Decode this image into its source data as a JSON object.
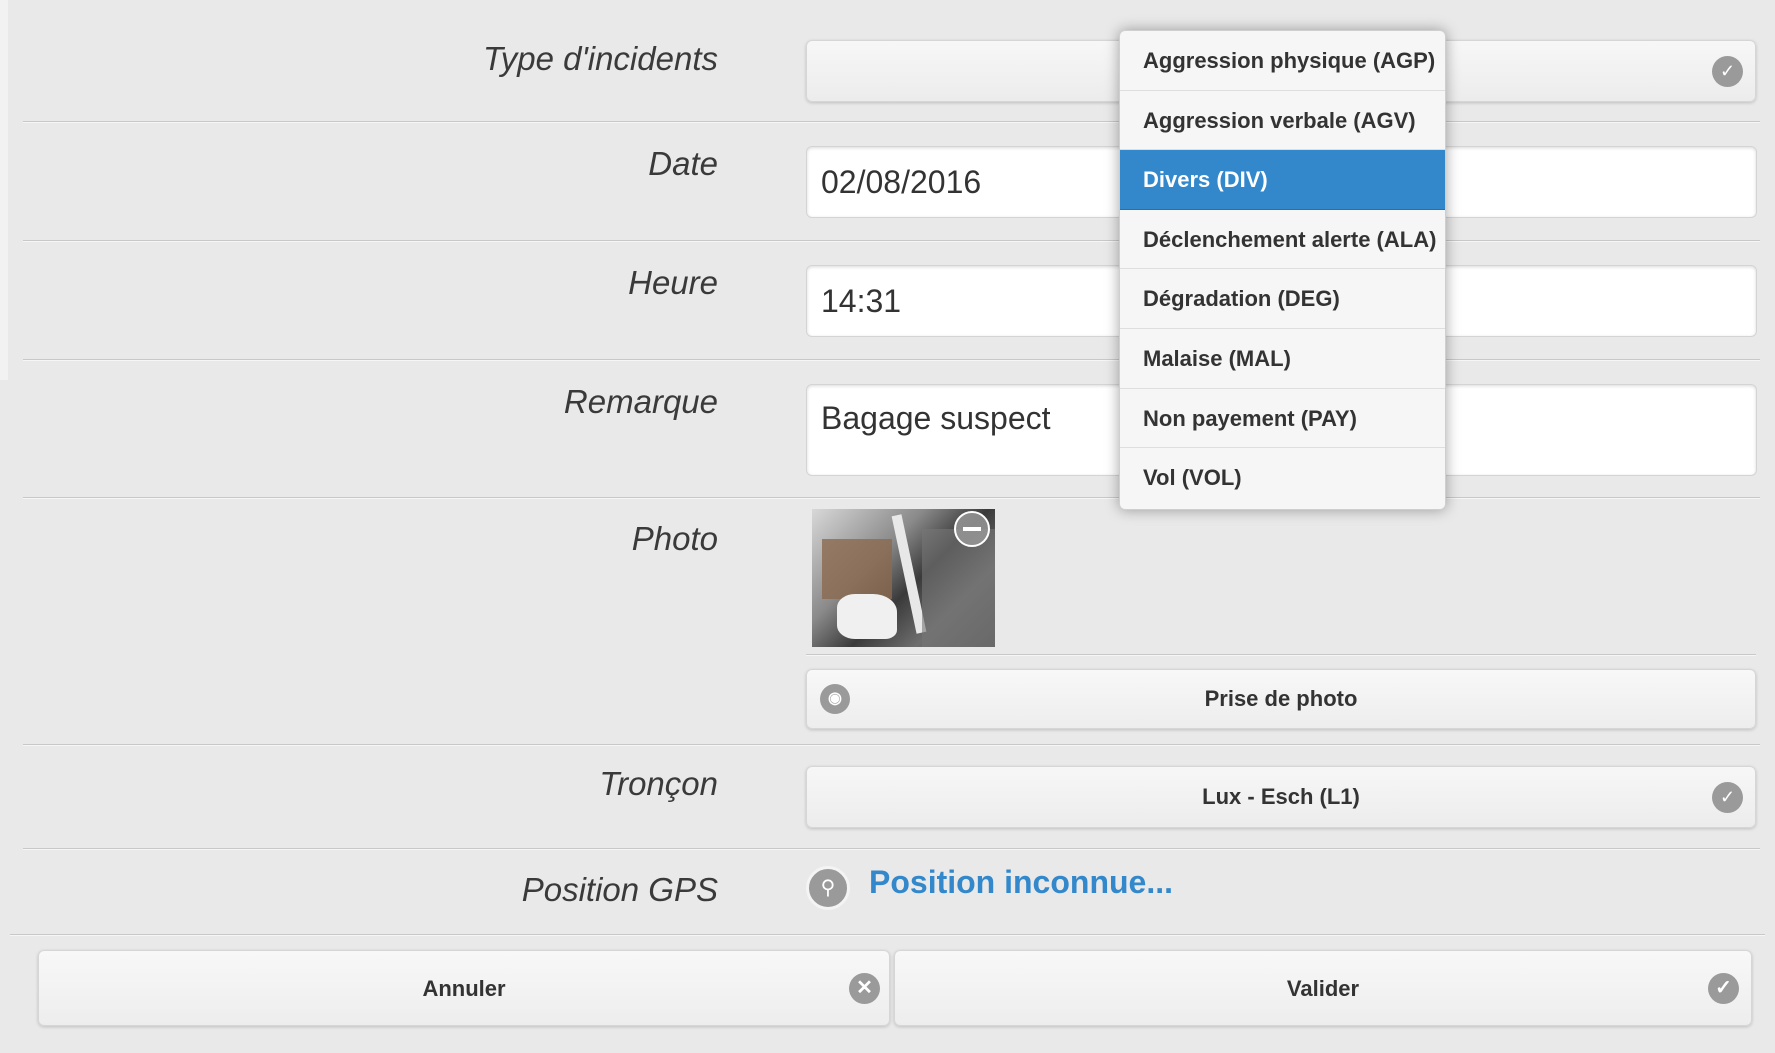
{
  "form": {
    "type_label": "Type d'incidents",
    "date_label": "Date",
    "date_value": "02/08/2016",
    "time_label": "Heure",
    "time_value": "14:31",
    "remark_label": "Remarque",
    "remark_value": "Bagage suspect",
    "photo_label": "Photo",
    "take_photo_label": "Prise de photo",
    "section_label": "Tronçon",
    "section_value": "Lux - Esch (L1)",
    "gps_label": "Position GPS",
    "gps_value": "Position inconnue..."
  },
  "dropdown": {
    "options": [
      "Aggression physique (AGP)",
      "Aggression verbale (AGV)",
      "Divers (DIV)",
      "Déclenchement alerte (ALA)",
      "Dégradation (DEG)",
      "Malaise (MAL)",
      "Non payement (PAY)",
      "Vol (VOL)"
    ],
    "selected": "Divers (DIV)"
  },
  "actions": {
    "cancel_label": "Annuler",
    "submit_label": "Valider"
  },
  "icons": {
    "chevron": "chevron-down-icon",
    "camera": "camera-icon",
    "location": "location-pin-icon",
    "remove": "minus-circle-icon",
    "cancel": "close-circle-icon",
    "submit": "check-circle-icon"
  },
  "colors": {
    "accent": "#3388cc",
    "background": "#e9e9e9"
  }
}
